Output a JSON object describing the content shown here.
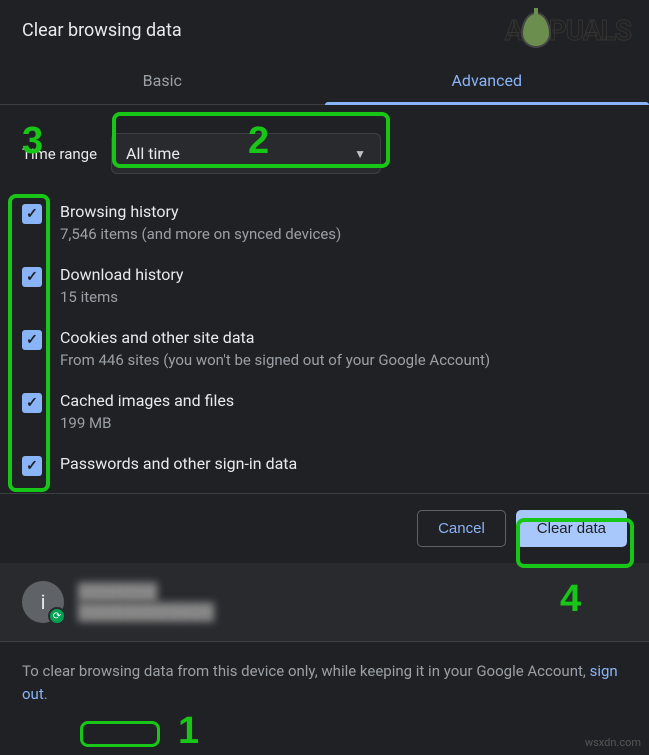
{
  "title": "Clear browsing data",
  "logo_text_left": "A",
  "logo_text_right": "PUALS",
  "tabs": {
    "basic": "Basic",
    "advanced": "Advanced"
  },
  "time_range": {
    "label": "Time range",
    "value": "All time"
  },
  "items": [
    {
      "title": "Browsing history",
      "sub": "7,546 items (and more on synced devices)",
      "checked": true
    },
    {
      "title": "Download history",
      "sub": "15 items",
      "checked": true
    },
    {
      "title": "Cookies and other site data",
      "sub": "From 446 sites (you won't be signed out of your Google Account)",
      "checked": true
    },
    {
      "title": "Cached images and files",
      "sub": "199 MB",
      "checked": true
    },
    {
      "title": "Passwords and other sign-in data",
      "sub": "",
      "checked": true
    }
  ],
  "buttons": {
    "cancel": "Cancel",
    "clear": "Clear data"
  },
  "account": {
    "initial": "i",
    "name": "███████",
    "email": "████████████"
  },
  "note": {
    "before": "To clear browsing data from this device only, while keeping it in your Google Account, ",
    "link": "sign out",
    "after": "."
  },
  "annotations": {
    "n1": "1",
    "n2": "2",
    "n3": "3",
    "n4": "4"
  },
  "watermark": "wsxdn.com"
}
